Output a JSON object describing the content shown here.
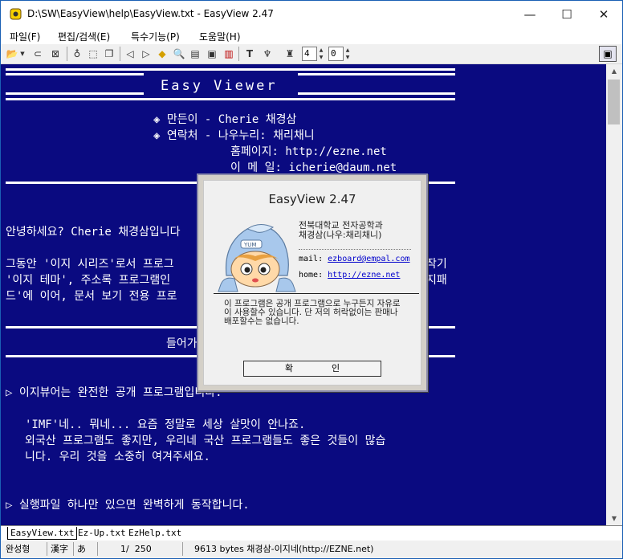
{
  "window": {
    "title": "D:\\SW\\EasyView\\help\\EasyView.txt - EasyView 2.47",
    "min_glyph": "—",
    "max_glyph": "☐",
    "close_glyph": "✕"
  },
  "menu": [
    {
      "label": "파일(F)"
    },
    {
      "label": "편집/검색(E)"
    },
    {
      "label": "특수기능(P)"
    },
    {
      "label": "도움말(H)"
    }
  ],
  "toolbar": {
    "spin1_value": "4",
    "spin2_value": "0"
  },
  "content": {
    "header": "Easy Viewer",
    "author": "◈ 만든이 - Cherie 채경삼",
    "contact": "◈ 연락처 - 나우누리: 채리채니",
    "homepage": "홈페이지: http://ezne.net",
    "email": "이 메 일: icherie@daum.net",
    "hello": "안녕하세요? Cherie 채경삼입니다",
    "p1_l1": "그동안 '이지 시리즈'로서 프로그",
    "p1_l1_end": "작기",
    "p1_l2": "'이지 테마', 주소록 프로그램인",
    "p1_l2_end": "지패",
    "p1_l3": "드'에 이어, 문서 보기 전용 프로",
    "section": "들어가",
    "bullet1": "▷ 이지뷰어는 완전한 공개 프로그램입니다.",
    "imf_l1": "'IMF'네.. 뭐네... 요즘 정말로 세상 살맛이 안나죠.",
    "imf_l2": "외국산 프로그램도 좋지만, 우리네 국산 프로그램들도 좋은 것들이 많습",
    "imf_l3": "니다. 우리 것을 소중히 여겨주세요.",
    "bullet2": "▷ 실행파일 하나만 있으면 완벽하게 동작합니다."
  },
  "tabs": [
    {
      "label": "EasyView.txt"
    },
    {
      "label": "Ez-Up.txt"
    },
    {
      "label": "EzHelp.txt"
    }
  ],
  "status": {
    "mode": "완성형",
    "charset": "漢字",
    "kana": "あ",
    "page": "1/  250",
    "info": "9613 bytes 채경삼-이지네(http://EZNE.net)"
  },
  "dialog": {
    "title": "EasyView 2.47",
    "school": "전북대학교 전자공학과",
    "name": "채경삼(나우:채리채니)",
    "mail_label": "mail:",
    "mail": "ezboard@empal.com",
    "home_label": "home:",
    "home": "http://ezne.net",
    "notice": "이 프로그램은 공개 프로그램으로 누구든지 자유로이 사용할수 있습니다. 단 저의 허락없이는 판매나 배포할수는 없습니다.",
    "ok": "확인",
    "mascot_badge": "YUM"
  },
  "colors": {
    "content_bg": "#0a0a80",
    "content_text": "#ffffff",
    "link": "#0000cc"
  }
}
